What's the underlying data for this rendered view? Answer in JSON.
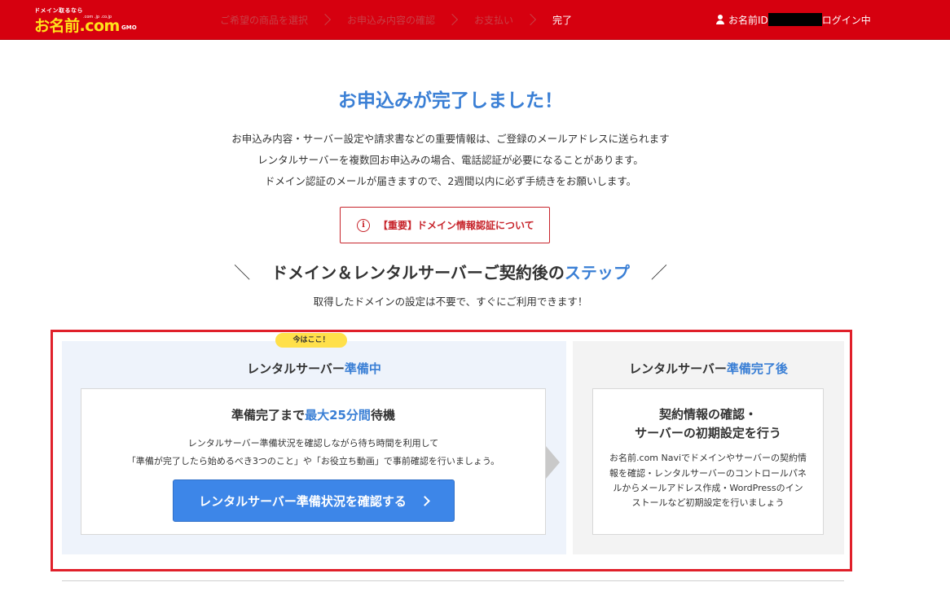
{
  "header": {
    "logo_small": "ドメイン取るなら",
    "logo_main": "お名前.com",
    "logo_tlds": ".com .jp .co.jp",
    "logo_gmo": "GMO",
    "steps": [
      "ご希望の商品を選択",
      "お申込み内容の確認",
      "お支払い",
      "完了"
    ],
    "login_prefix": "お名前ID",
    "login_suffix": "ログイン中"
  },
  "main": {
    "title": "お申込みが完了しました！",
    "notices": [
      "お申込み内容・サーバー設定や請求書などの重要情報は、ご登録のメールアドレスに送られます",
      "レンタルサーバーを複数回お申込みの場合、電話認証が必要になることがあります。",
      "ドメイン認証のメールが届きますので、2週間以内に必ず手続きをお願いします。"
    ],
    "alert_link": "【重要】ドメイン情報認証について",
    "alert_icon": "i",
    "steps_heading_pre": "ドメイン＆レンタルサーバーご契約後の",
    "steps_heading_hl": "ステップ",
    "slash_left": "＼",
    "slash_right": "／",
    "steps_sub": "取得したドメインの設定は不要で、すぐにご利用できます！"
  },
  "left_card": {
    "badge": "今はここ！",
    "title_pre": "レンタルサーバー",
    "title_hl": "準備中",
    "wait_pre": "準備完了まで",
    "wait_hl": "最大25分間",
    "wait_post": "待機",
    "desc_1": "レンタルサーバー準備状況を確認しながら待ち時間を利用して",
    "desc_2": "「準備が完了したら始めるべき3つのこと」や「お役立ち動画」で事前確認を行いましょう。",
    "cta": "レンタルサーバー準備状況を確認する"
  },
  "right_card": {
    "title_pre": "レンタルサーバー",
    "title_hl": "準備完了後",
    "sub_1": "契約情報の確認・",
    "sub_2": "サーバーの初期設定を行う",
    "desc": [
      "お名前.com Naviでドメインやサーバーの契約情",
      "報を確認・レンタルサーバーのコントロールパネ",
      "ルからメールアドレス作成・WordPressのイン",
      "ストールなど初期設定を行いましょう"
    ]
  },
  "colors": {
    "header_bg": "#d6000f",
    "accent_blue": "#3a7fd5",
    "alert_red": "#c7242b",
    "frame_red": "#e0202a",
    "badge_yellow": "#ffe04a",
    "cta_blue": "#3d86e8"
  }
}
